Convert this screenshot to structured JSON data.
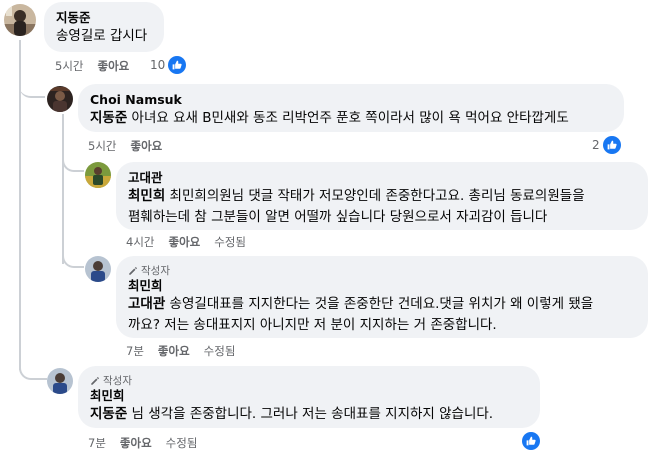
{
  "comments": [
    {
      "author": "지동준",
      "text": "송영길로 갑시다",
      "time": "5시간",
      "like_label": "좋아요",
      "reaction_count": "10"
    },
    {
      "author": "Choi Namsuk",
      "mention": "지동준",
      "text": " 아녀요 요새 B민새와 동조 리박언주 푼호 쪽이라서 많이 욕 먹어요 안타깝게도",
      "time": "5시간",
      "like_label": "좋아요",
      "reaction_count": "2"
    },
    {
      "author": "고대관",
      "mention": "최민희",
      "text_line1": " 최민희의원님 댓글 작태가 저모양인데 존중한다고요. 총리님 동료의원들을",
      "text_line2": "폄훼하는데 참 그분들이 알면 어떨까 싶습니다 당원으로서 자괴감이 듭니다",
      "time": "4시간",
      "like_label": "좋아요",
      "edited_label": "수정됨"
    },
    {
      "badge": "작성자",
      "author": "최민희",
      "mention": "고대관",
      "text_line1": " 송영길대표를 지지한다는 것을 존중한단 건데요.댓글 위치가 왜 이렇게 됐을",
      "text_line2": "까요? 저는 송대표지지 아니지만 저 분이 지지하는 거 존중합니다.",
      "time": "7분",
      "like_label": "좋아요",
      "edited_label": "수정됨"
    },
    {
      "badge": "작성자",
      "author": "최민희",
      "mention": "지동준",
      "text": " 님 생각을 존중합니다. 그러나 저는 송대표를 지지하지 않습니다.",
      "time": "7분",
      "like_label": "좋아요",
      "edited_label": "수정됨"
    }
  ],
  "colors": {
    "bubble_bg": "#f0f2f5",
    "like_blue": "#1877f2",
    "meta_gray": "#65676b",
    "thread_line": "#ccd0d5"
  },
  "icons": [
    "like-thumb-icon",
    "pencil-icon"
  ]
}
